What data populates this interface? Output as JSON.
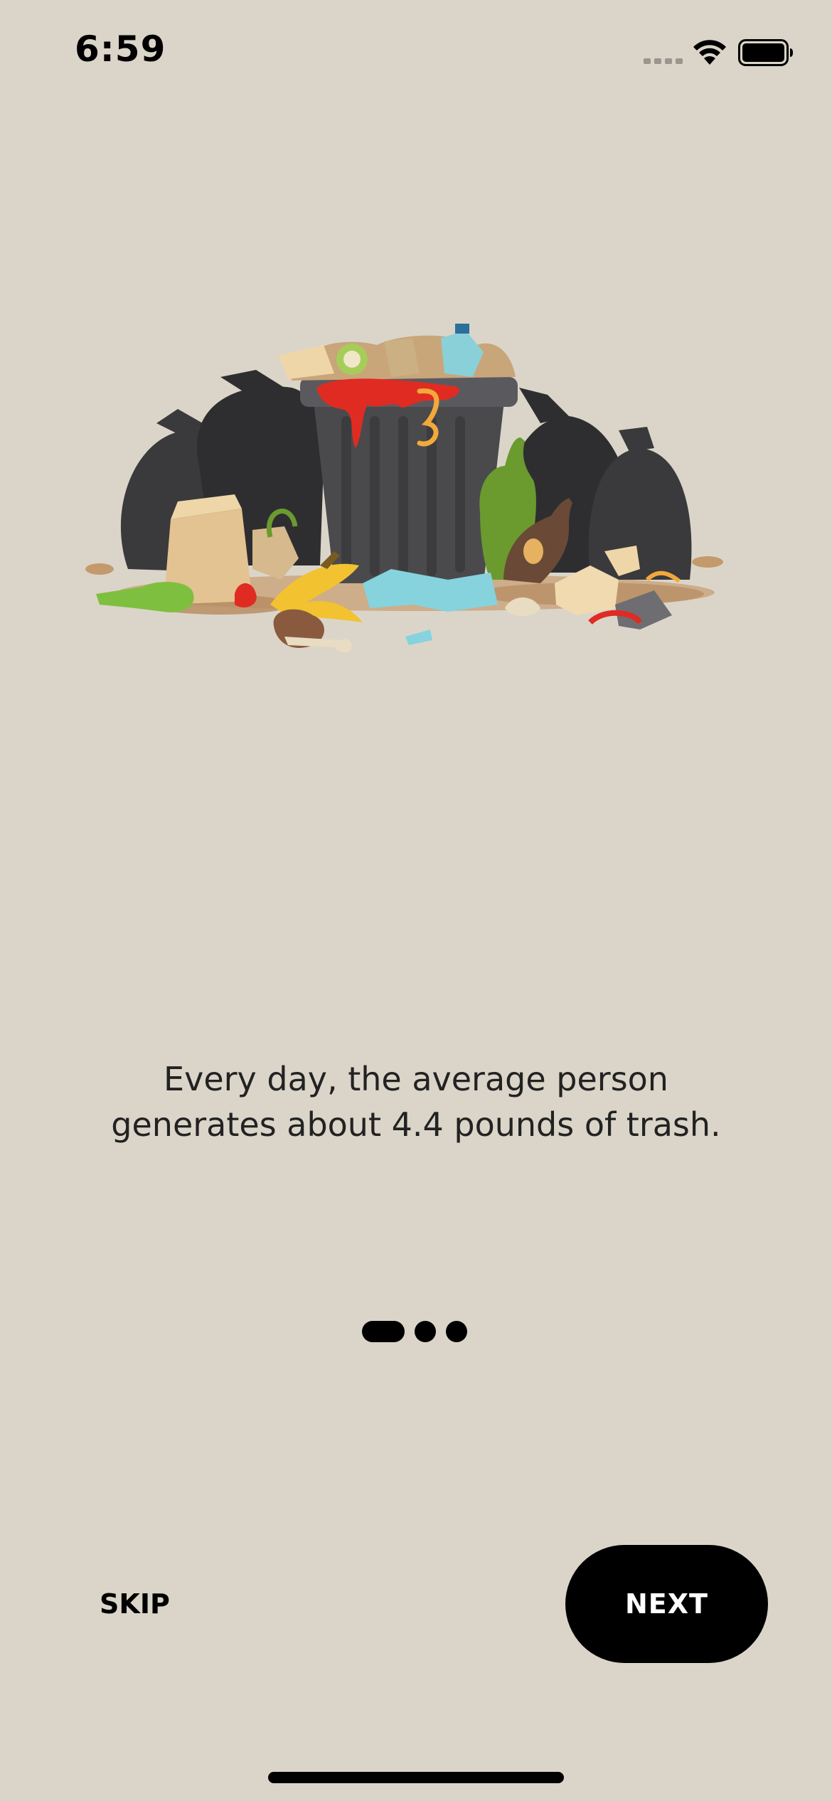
{
  "status_bar": {
    "time": "6:59"
  },
  "onboarding": {
    "illustration": "overflowing-trash-can-illustration",
    "message_line1": "Every day, the average person",
    "message_line2": "generates about 4.4 pounds of trash.",
    "page_index": 1,
    "page_count": 3
  },
  "actions": {
    "skip_label": "SKIP",
    "next_label": "NEXT"
  },
  "colors": {
    "background": "#dbd5c9",
    "primary": "#000000",
    "button_text": "#ffffff"
  }
}
